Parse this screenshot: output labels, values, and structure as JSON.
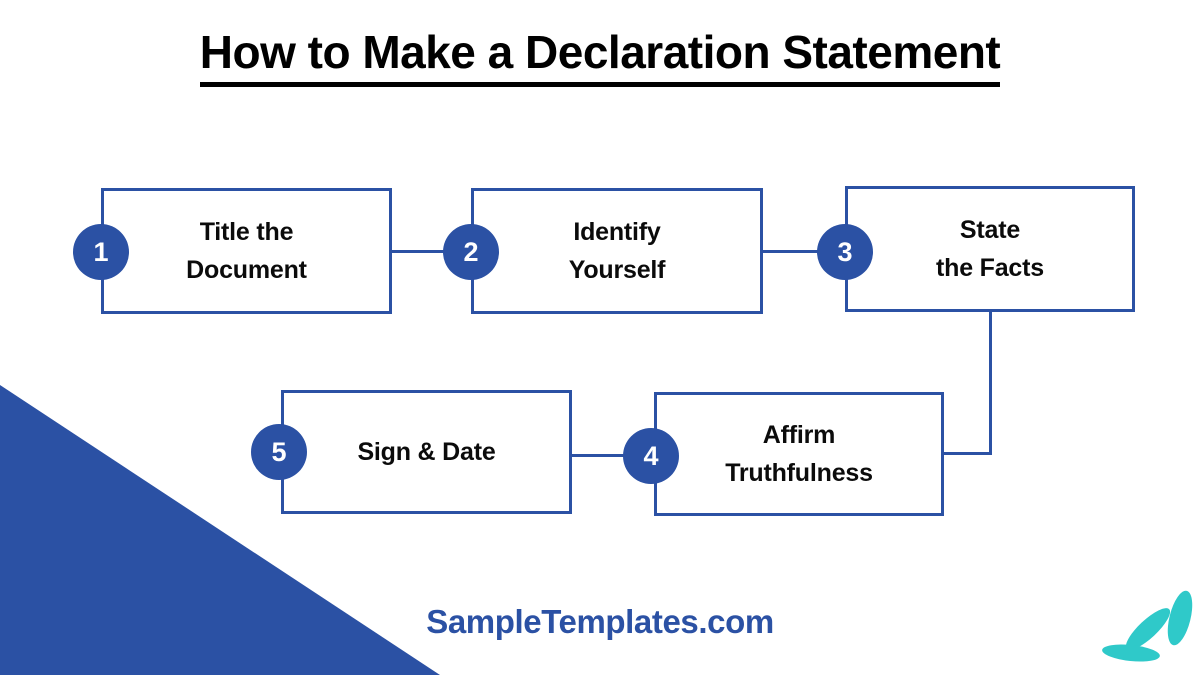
{
  "title": "How to Make a Declaration Statement",
  "brand": "SampleTemplates.com",
  "colors": {
    "accent_blue": "#2B51A4",
    "teal": "#2FC9C9",
    "text_black": "#0B0B0B",
    "background": "#FFFFFF"
  },
  "steps": [
    {
      "number": "1",
      "label": "Title the\nDocument"
    },
    {
      "number": "2",
      "label": "Identify\nYourself"
    },
    {
      "number": "3",
      "label": "State\nthe Facts"
    },
    {
      "number": "4",
      "label": "Affirm\nTruthfulness"
    },
    {
      "number": "5",
      "label": "Sign & Date"
    }
  ],
  "decorations": {
    "corner_triangle": "blue-triangle-bottom-left",
    "leaves": "teal-leaves-bottom-right"
  }
}
